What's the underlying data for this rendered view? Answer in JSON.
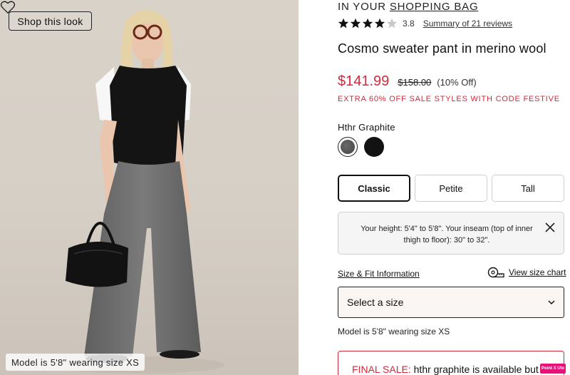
{
  "image": {
    "shop_look_label": "Shop this look",
    "model_caption": "Model is 5'8\" wearing size XS"
  },
  "product": {
    "bag_prefix": "IN YOUR ",
    "bag_link": "SHOPPING BAG",
    "rating": 3.8,
    "rating_label": "3.8",
    "stars_filled": 4,
    "reviews_label": "Summary of 21 reviews",
    "title": "Cosmo sweater pant in merino wool",
    "price_sale": "$141.99",
    "price_original": "$158.00",
    "price_off": "(10% Off)",
    "promo": "EXTRA 60% OFF SALE STYLES WITH CODE FESTIVE",
    "color_name": "Hthr Graphite",
    "swatches": [
      {
        "name": "Hthr Graphite",
        "color": "#555555",
        "selected": true
      },
      {
        "name": "Black",
        "color": "#121212",
        "selected": false
      }
    ],
    "fits": [
      {
        "label": "Classic",
        "active": true
      },
      {
        "label": "Petite",
        "active": false
      },
      {
        "label": "Tall",
        "active": false
      }
    ],
    "height_info": "Your height: 5'4\" to 5'8\". Your inseam (top of inner thigh to floor): 30\" to 32\".",
    "size_fit_link": "Size & Fit Information",
    "size_chart_link": "View size chart",
    "size_select": "Select a size",
    "model_note": "Model is 5'8\" wearing size XS",
    "final_sale_label": "FINAL SALE:",
    "final_sale_text": " hthr graphite is available but",
    "badge": "Point X Ute"
  },
  "colors": {
    "sale_red": "#d3293a",
    "badge_pink": "#e8117a"
  }
}
